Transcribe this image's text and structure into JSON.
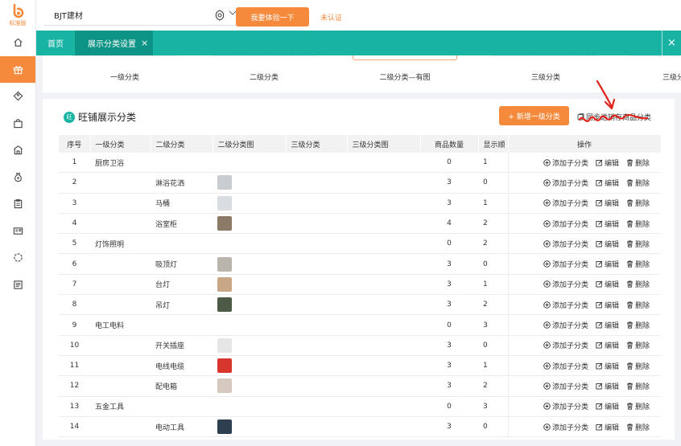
{
  "brand": {
    "name": "标准版",
    "accent": "#f5893c",
    "teal": "#19b3a4"
  },
  "sidebar": {
    "items": [
      {
        "icon": "home-icon"
      },
      {
        "icon": "gift-icon",
        "active": true
      },
      {
        "icon": "tag-icon"
      },
      {
        "icon": "bag-icon"
      },
      {
        "icon": "shop-icon"
      },
      {
        "icon": "money-bag-icon"
      },
      {
        "icon": "clipboard-icon"
      },
      {
        "icon": "id-card-icon"
      },
      {
        "icon": "refresh-circle-icon"
      },
      {
        "icon": "news-icon"
      }
    ]
  },
  "header": {
    "store": "BJT建材",
    "trial_button": "我要体验一下",
    "status": "未认证"
  },
  "tabs": [
    {
      "label": "首页"
    },
    {
      "label": "展示分类设置",
      "close": "×"
    }
  ],
  "tabbar_close": "×",
  "category_cards": [
    "一级分类",
    "二级分类",
    "二级分类—有图",
    "三级分类",
    "三级分"
  ],
  "panel": {
    "title": "旺铺展示分类",
    "title_icon": "旺",
    "add_button": "+ 新增一级分类",
    "sync_link": "同步进销存商品分类"
  },
  "table": {
    "columns": [
      "序号",
      "一级分类",
      "二级分类",
      "二级分类图",
      "三级分类",
      "三级分类图",
      "商品数量",
      "显示顺",
      "操作"
    ],
    "ops": {
      "add": "添加子分类",
      "edit": "编辑",
      "delete": "删除"
    },
    "rows": [
      {
        "no": "1",
        "l1": "厨房卫浴",
        "l2": "",
        "img": "",
        "count": "0",
        "order": "1"
      },
      {
        "no": "2",
        "l1": "",
        "l2": "淋浴花洒",
        "img": "#c9cdd2",
        "count": "3",
        "order": "0"
      },
      {
        "no": "3",
        "l1": "",
        "l2": "马桶",
        "img": "#d9dde2",
        "count": "3",
        "order": "1"
      },
      {
        "no": "4",
        "l1": "",
        "l2": "浴室柜",
        "img": "#8a7a66",
        "count": "4",
        "order": "2"
      },
      {
        "no": "5",
        "l1": "灯饰照明",
        "l2": "",
        "img": "",
        "count": "0",
        "order": "2"
      },
      {
        "no": "6",
        "l1": "",
        "l2": "吸顶灯",
        "img": "#b9b4ac",
        "count": "3",
        "order": "0"
      },
      {
        "no": "7",
        "l1": "",
        "l2": "台灯",
        "img": "#c8a786",
        "count": "3",
        "order": "1"
      },
      {
        "no": "8",
        "l1": "",
        "l2": "吊灯",
        "img": "#4d5a46",
        "count": "3",
        "order": "2"
      },
      {
        "no": "9",
        "l1": "电工电料",
        "l2": "",
        "img": "",
        "count": "0",
        "order": "3"
      },
      {
        "no": "10",
        "l1": "",
        "l2": "开关插座",
        "img": "#e6e6e6",
        "count": "3",
        "order": "0"
      },
      {
        "no": "11",
        "l1": "",
        "l2": "电线电缆",
        "img": "#d8352c",
        "count": "3",
        "order": "1"
      },
      {
        "no": "12",
        "l1": "",
        "l2": "配电箱",
        "img": "#d5c9c0",
        "count": "3",
        "order": "2"
      },
      {
        "no": "13",
        "l1": "五金工具",
        "l2": "",
        "img": "",
        "count": "0",
        "order": "3"
      },
      {
        "no": "14",
        "l1": "",
        "l2": "电动工具",
        "img": "#2f3f52",
        "count": "3",
        "order": "0"
      }
    ]
  }
}
